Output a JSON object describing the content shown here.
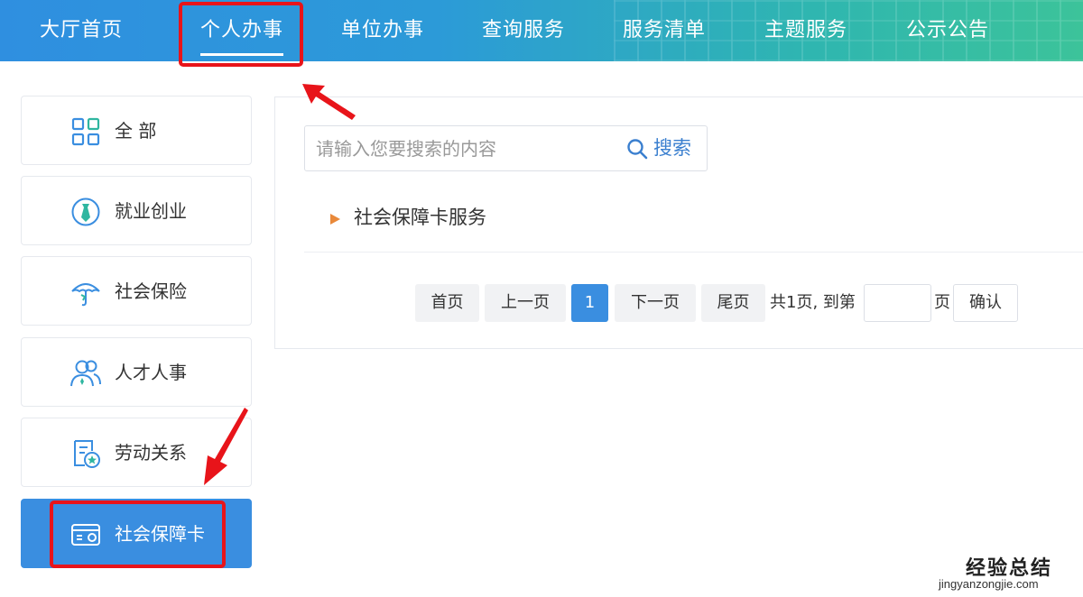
{
  "nav": {
    "items": [
      {
        "label": "大厅首页"
      },
      {
        "label": "个人办事",
        "active": true
      },
      {
        "label": "单位办事"
      },
      {
        "label": "查询服务"
      },
      {
        "label": "服务清单"
      },
      {
        "label": "主题服务"
      },
      {
        "label": "公示公告"
      }
    ]
  },
  "sidebar": {
    "items": [
      {
        "label": "全 部",
        "icon": "grid-icon"
      },
      {
        "label": "就业创业",
        "icon": "tie-icon"
      },
      {
        "label": "社会保险",
        "icon": "umbrella-icon"
      },
      {
        "label": "人才人事",
        "icon": "people-icon"
      },
      {
        "label": "劳动关系",
        "icon": "contract-icon"
      },
      {
        "label": "社会保障卡",
        "icon": "card-icon",
        "active": true
      }
    ]
  },
  "search": {
    "placeholder": "请输入您要搜索的内容",
    "value": "",
    "button_label": "搜索"
  },
  "results": [
    {
      "label": "社会保障卡服务"
    }
  ],
  "pagination": {
    "first": "首页",
    "prev": "上一页",
    "current": "1",
    "next": "下一页",
    "last": "尾页",
    "info": "共1页, 到第",
    "page_suffix": "页",
    "goto_value": "",
    "confirm": "确认"
  },
  "watermark": {
    "title": "经验总结",
    "url": "jingyanzongjie.com"
  },
  "colors": {
    "accent": "#3a8ee0",
    "annotation": "#e8141a",
    "result_marker": "#e9893a"
  }
}
